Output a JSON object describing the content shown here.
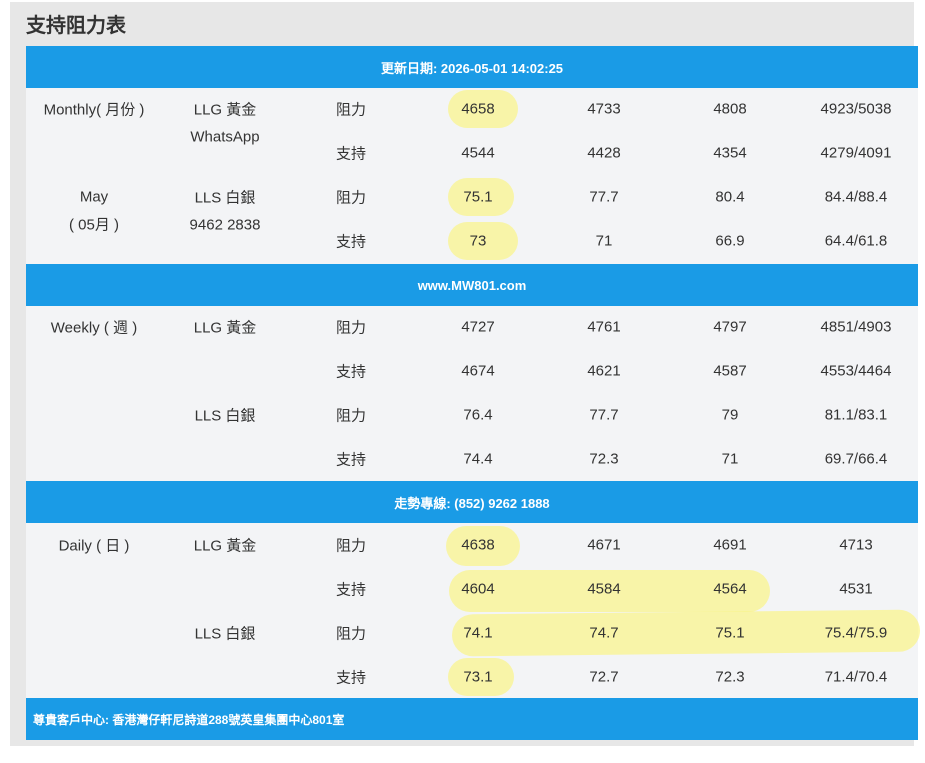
{
  "panel": {
    "title": "支持阻力表"
  },
  "bars": {
    "update": "更新日期: 2026-05-01 14:02:25",
    "website": "www.MW801.com",
    "hotline": "走勢專線: (852) 9262 1888",
    "footer": "尊貴客戶中心: 香港灣仔軒尼詩道288號英皇集團中心801室"
  },
  "monthly": {
    "period": "Monthly( 月份 )",
    "month": "May",
    "month_cn": "( 05月 )",
    "whatsapp_label": "WhatsApp",
    "phone": "9462 2838",
    "rows": [
      {
        "product": "LLG 黃金",
        "type": "阻力",
        "values": [
          "4658",
          "4733",
          "4808",
          "4923/5038"
        ]
      },
      {
        "product": "",
        "type": "支持",
        "values": [
          "4544",
          "4428",
          "4354",
          "4279/4091"
        ]
      },
      {
        "product": "LLS 白銀",
        "type": "阻力",
        "values": [
          "75.1",
          "77.7",
          "80.4",
          "84.4/88.4"
        ]
      },
      {
        "product": "",
        "type": "支持",
        "values": [
          "73",
          "71",
          "66.9",
          "64.4/61.8"
        ]
      }
    ]
  },
  "weekly": {
    "period": "Weekly ( 週 )",
    "rows": [
      {
        "product": "LLG 黃金",
        "type": "阻力",
        "values": [
          "4727",
          "4761",
          "4797",
          "4851/4903"
        ]
      },
      {
        "product": "",
        "type": "支持",
        "values": [
          "4674",
          "4621",
          "4587",
          "4553/4464"
        ]
      },
      {
        "product": "LLS 白銀",
        "type": "阻力",
        "values": [
          "76.4",
          "77.7",
          "79",
          "81.1/83.1"
        ]
      },
      {
        "product": "",
        "type": "支持",
        "values": [
          "74.4",
          "72.3",
          "71",
          "69.7/66.4"
        ]
      }
    ]
  },
  "daily": {
    "period": "Daily ( 日 )",
    "rows": [
      {
        "product": "LLG 黃金",
        "type": "阻力",
        "values": [
          "4638",
          "4671",
          "4691",
          "4713"
        ]
      },
      {
        "product": "",
        "type": "支持",
        "values": [
          "4604",
          "4584",
          "4564",
          "4531"
        ]
      },
      {
        "product": "LLS 白銀",
        "type": "阻力",
        "values": [
          "74.1",
          "74.7",
          "75.1",
          "75.4/75.9"
        ]
      },
      {
        "product": "",
        "type": "支持",
        "values": [
          "73.1",
          "72.7",
          "72.3",
          "71.4/70.4"
        ]
      }
    ]
  },
  "colors": {
    "bar_blue": "#1a9be6",
    "highlight": "#faf478"
  }
}
